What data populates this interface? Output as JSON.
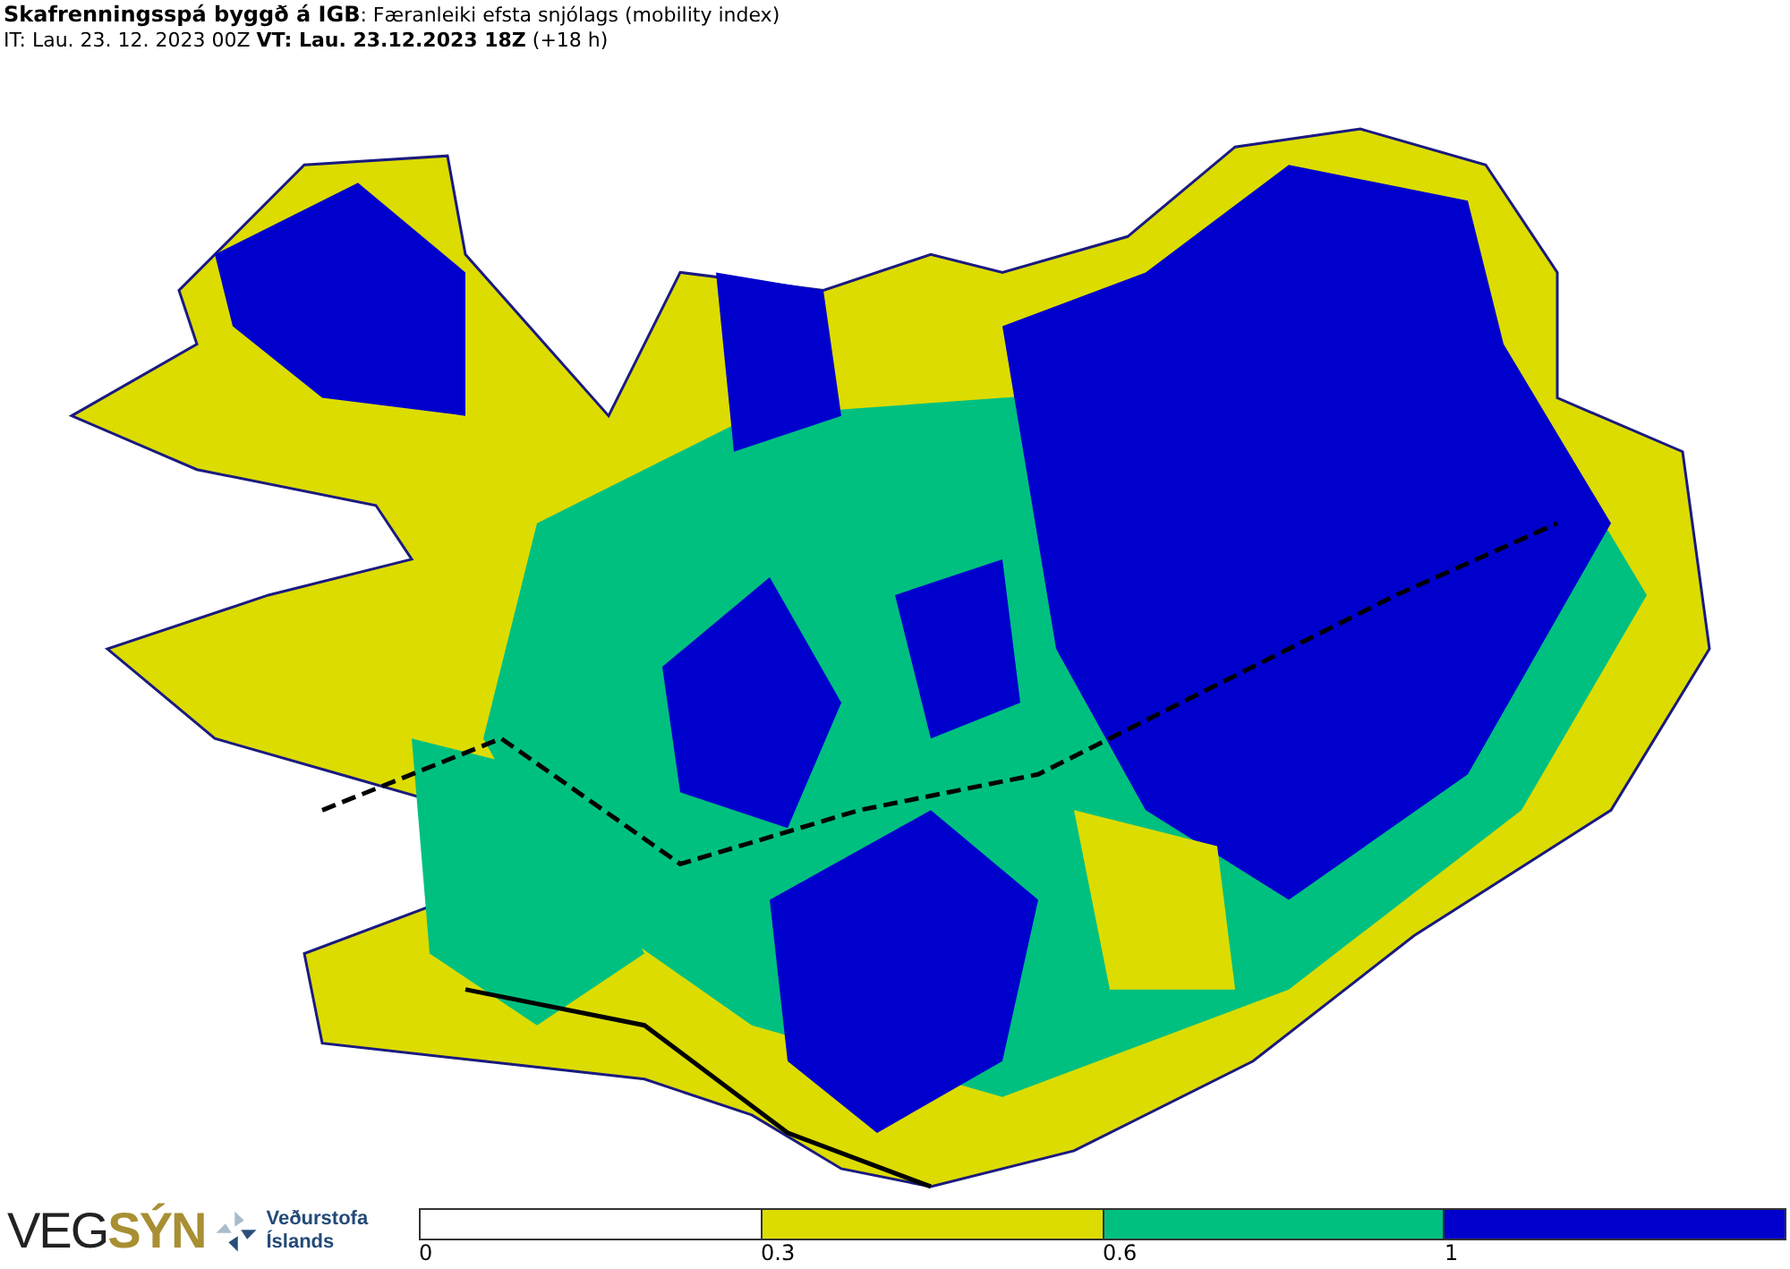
{
  "header": {
    "title": "Skafrenningsspá byggð á IGB",
    "subtitle": ": Færanleiki efsta snjólags (mobility index)",
    "it_label": "IT:",
    "it_value": "Lau. 23. 12. 2023 00Z",
    "vt_label": "VT:",
    "vt_value": "Lau. 23.12.2023 18Z",
    "offset": "(+18 h)"
  },
  "logos": {
    "vegsyn_plain": "VEG",
    "vegsyn_accent": "SÝN",
    "met_line1": "Veðurstofa",
    "met_line2": "Íslands"
  },
  "legend": {
    "segments": [
      {
        "color": "#ffffff"
      },
      {
        "color": "#dcdc00"
      },
      {
        "color": "#00c080"
      },
      {
        "color": "#0000cc"
      }
    ],
    "ticks": [
      "0",
      "0.3",
      "0.6",
      "1"
    ]
  }
}
